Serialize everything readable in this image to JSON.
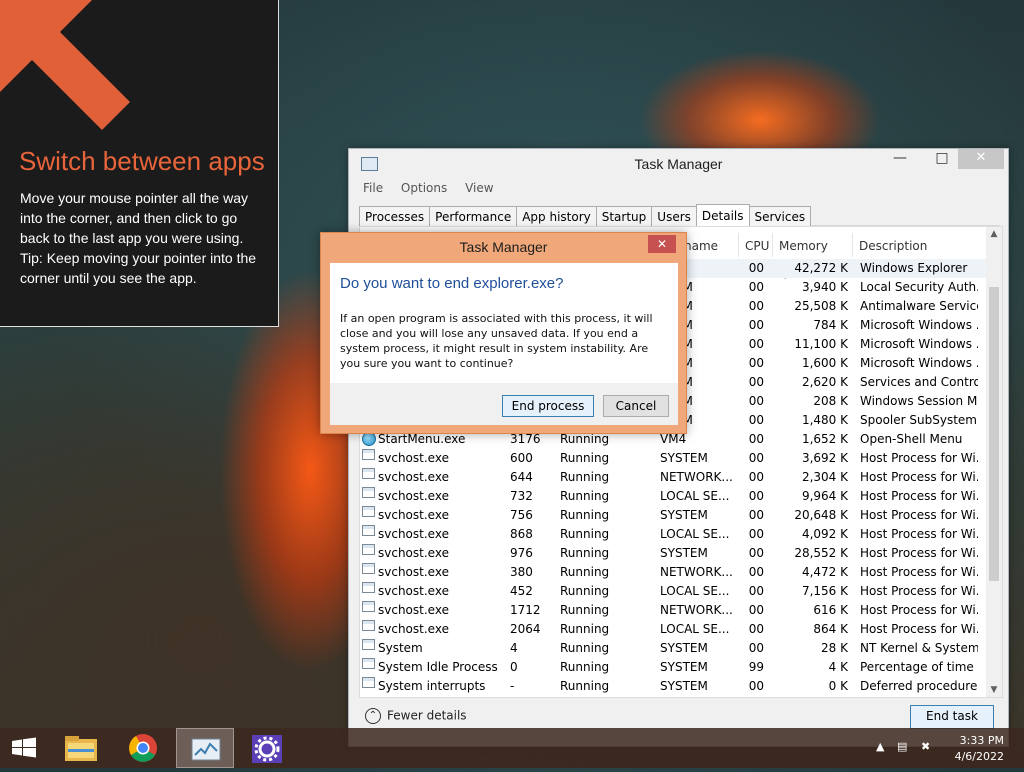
{
  "tip": {
    "title": "Switch between apps",
    "body": "Move your mouse pointer all the way into the corner, and then click to go back to the last app you were using.",
    "tip": "Tip: Keep moving your pointer into the corner until you see the app.",
    "arrow_color": "#e0603a"
  },
  "taskmgr": {
    "title": "Task Manager",
    "menu": [
      "File",
      "Options",
      "View"
    ],
    "tabs": [
      "Processes",
      "Performance",
      "App history",
      "Startup",
      "Users",
      "Details",
      "Services"
    ],
    "active_tab": "Details",
    "columns": {
      "name": "name",
      "cpu": "CPU",
      "memory": "Memory (p...",
      "description": "Description"
    },
    "rows": [
      {
        "name": "",
        "pid": "",
        "status": "",
        "user": "",
        "cpu": "00",
        "mem": "42,272 K",
        "desc": "Windows Explorer"
      },
      {
        "name": "",
        "pid": "",
        "status": "",
        "user": "STEM",
        "cpu": "00",
        "mem": "3,940 K",
        "desc": "Local Security Auth..."
      },
      {
        "name": "",
        "pid": "",
        "status": "",
        "user": "STEM",
        "cpu": "00",
        "mem": "25,508 K",
        "desc": "Antimalware Service..."
      },
      {
        "name": "",
        "pid": "",
        "status": "",
        "user": "STEM",
        "cpu": "00",
        "mem": "784 K",
        "desc": "Microsoft Windows ..."
      },
      {
        "name": "",
        "pid": "",
        "status": "",
        "user": "STEM",
        "cpu": "00",
        "mem": "11,100 K",
        "desc": "Microsoft Windows ..."
      },
      {
        "name": "",
        "pid": "",
        "status": "",
        "user": "STEM",
        "cpu": "00",
        "mem": "1,600 K",
        "desc": "Microsoft Windows ..."
      },
      {
        "name": "",
        "pid": "",
        "status": "",
        "user": "STEM",
        "cpu": "00",
        "mem": "2,620 K",
        "desc": "Services and Control..."
      },
      {
        "name": "",
        "pid": "",
        "status": "",
        "user": "STEM",
        "cpu": "00",
        "mem": "208 K",
        "desc": "Windows Session M..."
      },
      {
        "name": "",
        "pid": "",
        "status": "",
        "user": "STEM",
        "cpu": "00",
        "mem": "1,480 K",
        "desc": "Spooler SubSystem ..."
      },
      {
        "name": "StartMenu.exe",
        "pid": "3176",
        "status": "Running",
        "user": "VM4",
        "cpu": "00",
        "mem": "1,652 K",
        "desc": "Open-Shell Menu",
        "icon": "globe"
      },
      {
        "name": "svchost.exe",
        "pid": "600",
        "status": "Running",
        "user": "SYSTEM",
        "cpu": "00",
        "mem": "3,692 K",
        "desc": "Host Process for Wi..."
      },
      {
        "name": "svchost.exe",
        "pid": "644",
        "status": "Running",
        "user": "NETWORK...",
        "cpu": "00",
        "mem": "2,304 K",
        "desc": "Host Process for Wi..."
      },
      {
        "name": "svchost.exe",
        "pid": "732",
        "status": "Running",
        "user": "LOCAL SE...",
        "cpu": "00",
        "mem": "9,964 K",
        "desc": "Host Process for Wi..."
      },
      {
        "name": "svchost.exe",
        "pid": "756",
        "status": "Running",
        "user": "SYSTEM",
        "cpu": "00",
        "mem": "20,648 K",
        "desc": "Host Process for Wi..."
      },
      {
        "name": "svchost.exe",
        "pid": "868",
        "status": "Running",
        "user": "LOCAL SE...",
        "cpu": "00",
        "mem": "4,092 K",
        "desc": "Host Process for Wi..."
      },
      {
        "name": "svchost.exe",
        "pid": "976",
        "status": "Running",
        "user": "SYSTEM",
        "cpu": "00",
        "mem": "28,552 K",
        "desc": "Host Process for Wi..."
      },
      {
        "name": "svchost.exe",
        "pid": "380",
        "status": "Running",
        "user": "NETWORK...",
        "cpu": "00",
        "mem": "4,472 K",
        "desc": "Host Process for Wi..."
      },
      {
        "name": "svchost.exe",
        "pid": "452",
        "status": "Running",
        "user": "LOCAL SE...",
        "cpu": "00",
        "mem": "7,156 K",
        "desc": "Host Process for Wi..."
      },
      {
        "name": "svchost.exe",
        "pid": "1712",
        "status": "Running",
        "user": "NETWORK...",
        "cpu": "00",
        "mem": "616 K",
        "desc": "Host Process for Wi..."
      },
      {
        "name": "svchost.exe",
        "pid": "2064",
        "status": "Running",
        "user": "LOCAL SE...",
        "cpu": "00",
        "mem": "864 K",
        "desc": "Host Process for Wi..."
      },
      {
        "name": "System",
        "pid": "4",
        "status": "Running",
        "user": "SYSTEM",
        "cpu": "00",
        "mem": "28 K",
        "desc": "NT Kernel & System"
      },
      {
        "name": "System Idle Process",
        "pid": "0",
        "status": "Running",
        "user": "SYSTEM",
        "cpu": "99",
        "mem": "4 K",
        "desc": "Percentage of time t..."
      },
      {
        "name": "System interrupts",
        "pid": "-",
        "status": "Running",
        "user": "SYSTEM",
        "cpu": "00",
        "mem": "0 K",
        "desc": "Deferred procedure ..."
      }
    ],
    "fewer_details": "Fewer details",
    "end_task": "End task"
  },
  "dialog": {
    "title": "Task Manager",
    "question": "Do you want to end explorer.exe?",
    "message": "If an open program is associated with this process, it will close and you will lose any unsaved data. If you end a system process, it might result in system instability. Are you sure you want to continue?",
    "end_process": "End process",
    "cancel": "Cancel",
    "close_glyph": "✕"
  },
  "taskbar": {
    "items": [
      "start-icon",
      "file-explorer-icon",
      "chrome-icon",
      "task-manager-icon",
      "settings-icon"
    ],
    "time": "3:33 PM",
    "date": "4/6/2022"
  }
}
